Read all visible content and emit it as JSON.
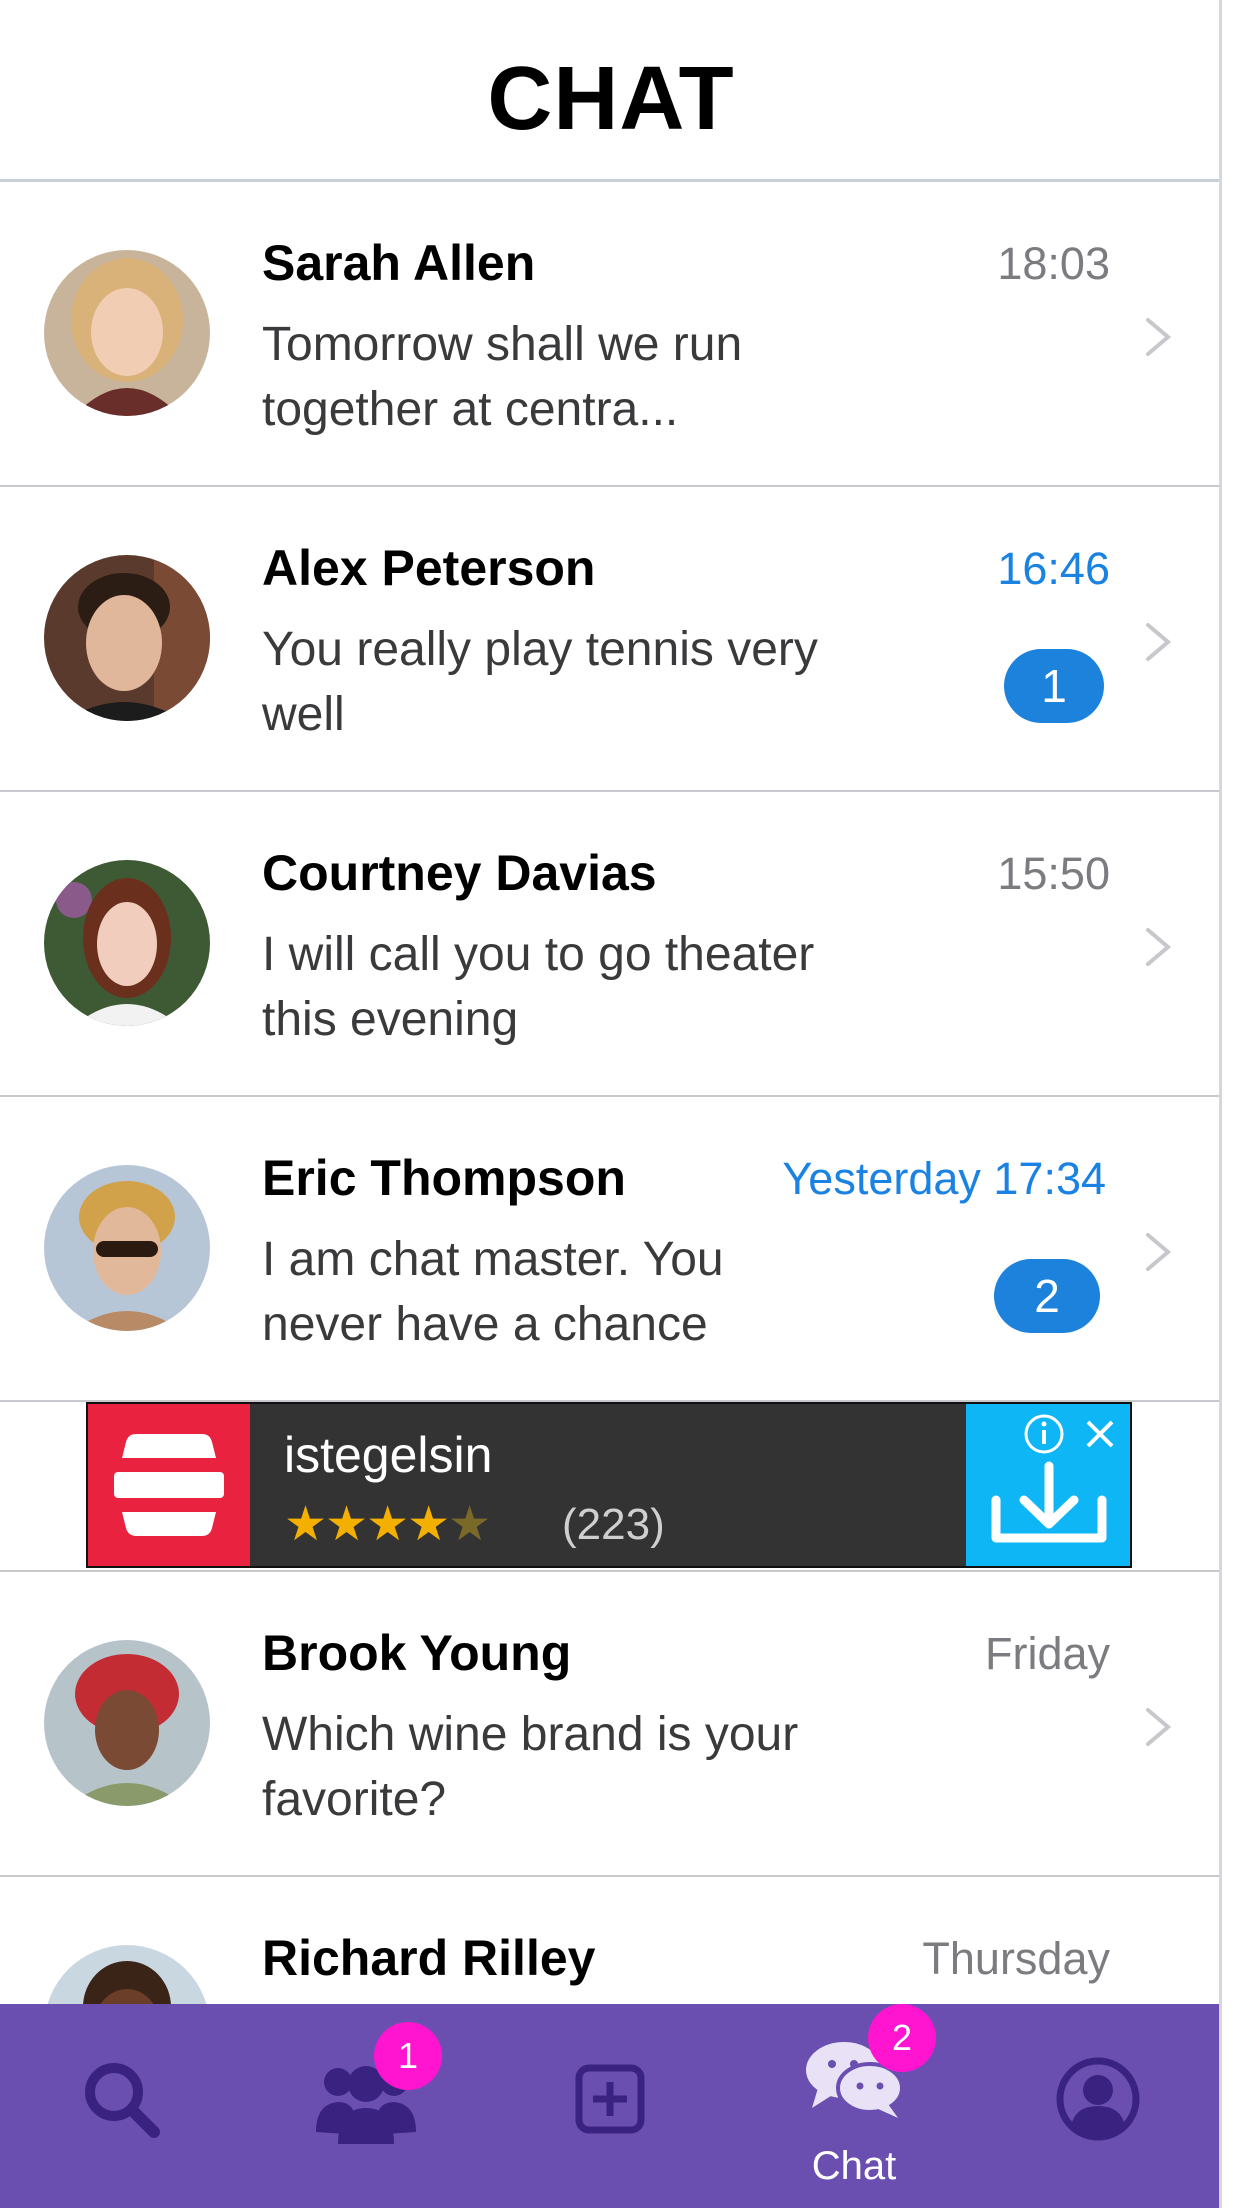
{
  "header": {
    "title": "CHAT"
  },
  "chats": [
    {
      "name": "Sarah Allen",
      "time": "18:03",
      "unread_time": false,
      "message": "Tomorrow shall we run together at centra...",
      "badge": ""
    },
    {
      "name": "Alex Peterson",
      "time": "16:46",
      "unread_time": true,
      "message": "You really play tennis very well",
      "badge": "1"
    },
    {
      "name": "Courtney Davias",
      "time": "15:50",
      "unread_time": false,
      "message": "I will call you to go theater this evening",
      "badge": ""
    },
    {
      "name": "Eric Thompson",
      "time": "Yesterday 17:34",
      "unread_time": true,
      "message": "I am chat master. You never have a chance",
      "badge": "2"
    },
    {
      "name": "Brook Young",
      "time": "Friday",
      "unread_time": false,
      "message": "Which wine brand is your favorite?",
      "badge": ""
    },
    {
      "name": "Richard Rilley",
      "time": "Thursday",
      "unread_time": false,
      "message": "",
      "badge": ""
    }
  ],
  "ad": {
    "title": "istegelsin",
    "stars": "★★★★",
    "star_dim": "★",
    "rating_count": "(223)",
    "rating": 4.5
  },
  "tabbar": {
    "tabs": [
      {
        "id": "search",
        "icon": "search-icon",
        "label": "",
        "badge": ""
      },
      {
        "id": "friends",
        "icon": "people-icon",
        "label": "",
        "badge": "1"
      },
      {
        "id": "add",
        "icon": "add-square-icon",
        "label": "",
        "badge": ""
      },
      {
        "id": "chat",
        "icon": "chat-bubbles-icon",
        "label": "Chat",
        "badge": "2",
        "active": true
      },
      {
        "id": "profile",
        "icon": "profile-icon",
        "label": "",
        "badge": ""
      }
    ]
  },
  "colors": {
    "accent_blue": "#1a82e2",
    "badge_blue": "#1d82dc",
    "tabbar_purple": "#6a4fb0",
    "tab_badge_pink": "#ff14d0",
    "ad_red": "#e8223f",
    "ad_cyan": "#0fb6f5"
  }
}
